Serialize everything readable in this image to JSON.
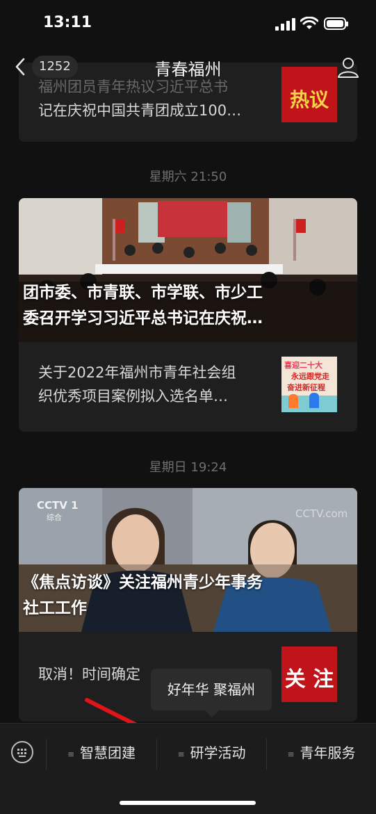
{
  "status": {
    "time": "13:11"
  },
  "nav": {
    "back_count": "1252",
    "title": "青春福州"
  },
  "card1": {
    "line1": "福州团员青年热议习近平总书",
    "line2": "记在庆祝中国共青团成立100…",
    "thumb_text": "热议"
  },
  "sep1": "星期六 21:50",
  "card2": {
    "title_line1": "团市委、市青联、市学联、市少工",
    "title_line2": "委召开学习习近平总书记在庆祝…",
    "item_line1": "关于2022年福州市青年社会组",
    "item_line2": "织优秀项目案例拟入选名单…",
    "thumb_text1": "喜迎二十大",
    "thumb_text2": "永远跟党走",
    "thumb_text3": "奋进新征程"
  },
  "sep2": "星期日 19:24",
  "card3": {
    "logo1": "CCTV 1",
    "logo1_sub": "综合",
    "logo2": "CCTV.com",
    "title_line1": "《焦点访谈》关注福州青少年事务",
    "title_line2": "社工工作",
    "item_text": "取消！时间确定",
    "thumb_text": "关 注"
  },
  "popup": {
    "label": "好年华 聚福州"
  },
  "tabs": [
    {
      "label": "智慧团建"
    },
    {
      "label": "研学活动"
    },
    {
      "label": "青年服务"
    }
  ],
  "colors": {
    "background": "#111111",
    "card": "#1f1f1f",
    "arrow": "#e1141a",
    "badge": "#2a2a2a"
  }
}
